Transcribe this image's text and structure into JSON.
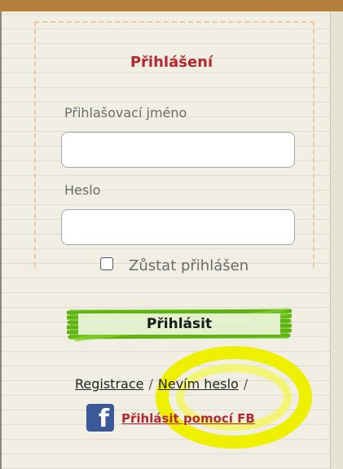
{
  "login": {
    "title": "Přihlášení",
    "username_label": "Přihlašovací jméno",
    "username_value": "",
    "password_label": "Heslo",
    "password_value": "",
    "remember_label": "Zůstat přihlášen",
    "remember_checked": false,
    "submit_label": "Přihlásit"
  },
  "links": {
    "register": "Registrace",
    "forgot_password": "Nevím heslo",
    "separator": "/",
    "facebook_login": "Přihlásit pomocí FB"
  },
  "icons": {
    "facebook": "facebook-icon"
  },
  "colors": {
    "title": "#b42830",
    "button_scribble": "#6fc21c",
    "highlight": "#eef000",
    "facebook": "#3b5998"
  }
}
